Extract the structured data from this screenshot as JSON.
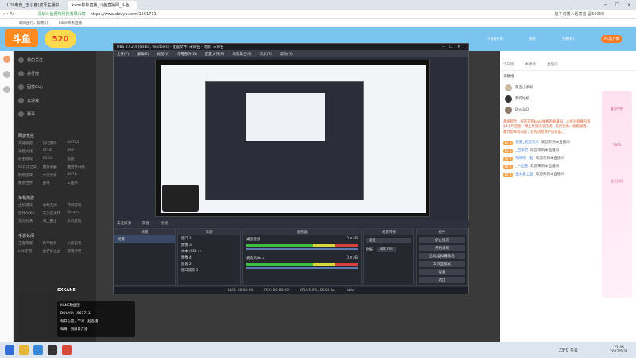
{
  "browser": {
    "tabs": [
      "LOL电竞_ 王小鹿(虎牙主播中)",
      "kane彬彬直播_斗鱼直播网_斗鱼..."
    ],
    "url": "https://www.douyu.com/1561711",
    "secure_label": "深圳斗鱼网络科技有限公司",
    "bookmarks": [
      "聊阅部行，帮我们",
      "kane彬彬直播"
    ],
    "user_badge": "奶子说懂人话童昔 留50008"
  },
  "douyu": {
    "logo_text": "斗鱼",
    "anniversary": "520",
    "side_items": [
      "我的关注",
      "排行榜",
      "回放中心",
      "云游戏",
      "赛事"
    ],
    "section_hot": "网游竞技",
    "hot_grid": [
      "英雄联盟",
      "热门游戏",
      "DOTA2",
      "穿越火线",
      "CFHD",
      "DNF",
      "射击游戏",
      "CSGO",
      "逃跑",
      "lol云顶之弈",
      "魔兽争霸",
      "魔兽怀旧服",
      "网络游戏",
      "守望先锋",
      "DOTA",
      "魔兽世界",
      "部落",
      "三国杀"
    ],
    "section_mobile": "单机热游",
    "mobile_grid": [
      "主机游戏",
      "永劫无间",
      "怀旧游戏",
      "原神APEX",
      "艾尔登法环",
      "Steam",
      "无尽对决",
      "海上霸主",
      "单机游戏"
    ],
    "section_fun": "手游休闲",
    "fun_grid": [
      "王者荣耀",
      "和平精英",
      "火影忍者",
      "LOL手游",
      "金铲铲之战",
      "部落冲突"
    ],
    "header_icons": [
      "下载客户端",
      "鱼吧",
      "主播排行",
      "开播",
      "立即开播"
    ],
    "pc_button": "PC客户端"
  },
  "obs": {
    "title": "OBS 27.2.4 (64-bit, windows) - 配置文件: 未命名 - 场景: 未命名",
    "menu": [
      "文件(F)",
      "编辑(E)",
      "视图(V)",
      "停靠部件(D)",
      "配置文件(P)",
      "场景集合(S)",
      "工具(T)",
      "帮助(H)"
    ],
    "source_bar": [
      "未选择源",
      "属性",
      "滤镜"
    ],
    "panels": [
      "场景",
      "来源",
      "混音器",
      "场景转换",
      "控件"
    ],
    "scene_item": "场景",
    "sources": [
      "窗口 1",
      "图像 3",
      "文本 (GDI+)",
      "图像 4",
      "图像 2",
      "窗口捕获 3"
    ],
    "mixer": [
      {
        "name": "桌面音频",
        "db": "0.0 dB"
      },
      {
        "name": "麦克风/Aux",
        "db": "0.0 dB"
      }
    ],
    "transition": {
      "type": "渐变",
      "duration_label": "时长",
      "duration": "300 ms"
    },
    "controls": [
      "停止推流",
      "开始录制",
      "启动虚拟摄像机",
      "工作室模式",
      "设置",
      "退出"
    ],
    "status": {
      "live": "LIVE: 00:00:00",
      "rec": "REC: 00:00:00",
      "cpu": "CPU: 5.9%, 60.00 fps",
      "kbps": "kb/s"
    }
  },
  "right": {
    "tabs": [
      "今日榜",
      "本周榜",
      "直播间"
    ],
    "contribution_title": "贡献榜",
    "ranks": [
      {
        "name": "最吉小手机",
        "tag": "1"
      },
      {
        "name": "我得姑娘",
        "tag": "2"
      },
      {
        "name": "BreOnD",
        "tag": "3"
      }
    ],
    "system_msg": "系统提示：欢迎来到kane彬彬的直播间，斗鱼对直播内容24小时巡查，禁止传播违法违规、低俗色情、吸烟酗酒、暴力恐怖等内容，若有违反将严厉处置。",
    "chat": [
      {
        "lv": "LV 4",
        "user": "玩家_欢迎点点",
        "text": "欢迎来到本直播间"
      },
      {
        "lv": "LV 4",
        "user": "_回来吧",
        "text": "欢迎来到本直播间"
      },
      {
        "lv": "LV 3",
        "user": "嗨嗨嗨一起",
        "text": "欢迎来到本直播间"
      },
      {
        "lv": "LV 5",
        "user": "_一起看",
        "text": "欢迎来到本直播间"
      },
      {
        "lv": "LV 4",
        "user": "鱼丸爱上鱼",
        "text": "欢迎来到本直播间"
      }
    ],
    "promo_labels": [
      "爱奇守护",
      "1000",
      "金光闪闪"
    ]
  },
  "overlay": {
    "streamer_tag": "SXKANE",
    "lines": [
      "KANE粉丝团",
      "DOUYU: 1561711",
      "每日心愿，学习一起直播",
      "每周一到周日开播"
    ]
  },
  "taskbar": {
    "weather": "23°C 多云",
    "time": "21:44",
    "date": "2022/5/21"
  },
  "colors": {
    "douyu_orange": "#ff7a24",
    "obs_dark": "#2b2e38",
    "taskbar": "#dde6f0"
  }
}
